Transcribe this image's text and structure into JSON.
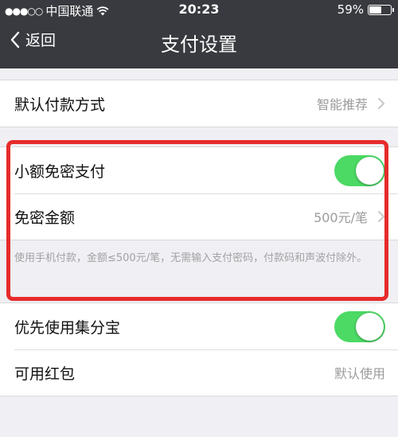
{
  "status_bar": {
    "signal": "●●●○○",
    "carrier": "中国联通",
    "time": "20:23",
    "battery_text": "59%",
    "battery_level": 0.59
  },
  "nav": {
    "back_label": "返回",
    "title": "支付设置"
  },
  "rows": {
    "default_payment": {
      "label": "默认付款方式",
      "value": "智能推荐"
    },
    "small_free": {
      "label": "小额免密支付",
      "enabled": true
    },
    "free_amount": {
      "label": "免密金额",
      "value": "500元/笔"
    },
    "note": "使用手机付款，金额≤500元/笔，无需输入支付密码，付款码和声波付除外。",
    "jifenbao": {
      "label": "优先使用集分宝",
      "enabled": true
    },
    "red_packet": {
      "label": "可用红包",
      "value": "默认使用"
    }
  },
  "colors": {
    "header_bg": "#393a3f",
    "switch_on": "#4cd964",
    "highlight": "#e62b2b"
  }
}
